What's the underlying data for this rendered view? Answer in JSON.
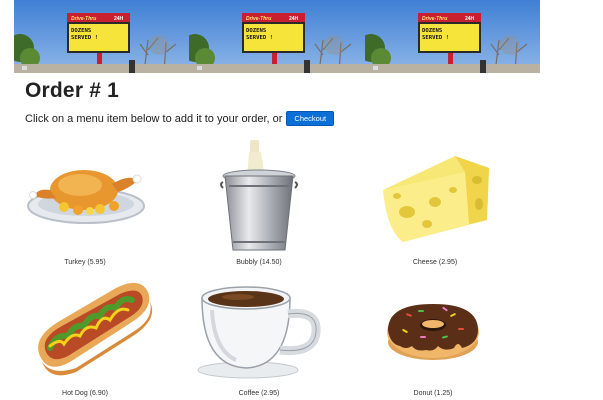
{
  "banner": {
    "sign_header": "Drive-Thru",
    "sign_badge": "24H",
    "sign_line1": "DOZENS",
    "sign_line2": "SERVED !"
  },
  "page": {
    "title": "Order # 1",
    "intro_text": "Click on a menu item below to add it to your order, or",
    "checkout_label": "Checkout"
  },
  "menu": {
    "items": [
      {
        "label": "Turkey (5.95)",
        "icon": "roast-turkey"
      },
      {
        "label": "Bubbly (14.50)",
        "icon": "champagne-bucket"
      },
      {
        "label": "Cheese (2.95)",
        "icon": "cheese-wedge"
      },
      {
        "label": "Hot Dog (6.90)",
        "icon": "hot-dog"
      },
      {
        "label": "Coffee (2.95)",
        "icon": "coffee-cup"
      },
      {
        "label": "Donut (1.25)",
        "icon": "donut"
      }
    ]
  },
  "colors": {
    "sky": "#5b90d6",
    "sign_yellow": "#f7e43a",
    "sign_red": "#c8202e",
    "button_blue": "#0a6fd6"
  }
}
